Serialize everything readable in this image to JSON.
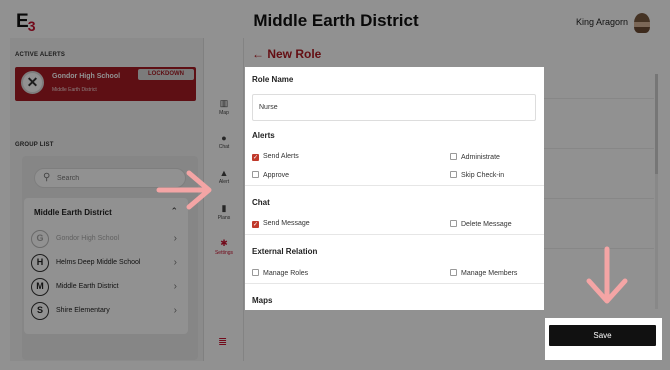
{
  "header": {
    "logo": "E",
    "logo_sub": "3",
    "title": "Middle Earth District",
    "user_name": "King Aragorn"
  },
  "sidebar": {
    "active_alerts_label": "ACTIVE ALERTS",
    "alert": {
      "school": "Gondor High School",
      "district": "Middle Earth District",
      "status": "LOCKDOWN"
    },
    "group_list_label": "GROUP LIST",
    "search_placeholder": "Search",
    "district_name": "Middle Earth District",
    "schools": [
      {
        "initial": "G",
        "name": "Gondor High School"
      },
      {
        "initial": "H",
        "name": "Helms Deep Middle School"
      },
      {
        "initial": "M",
        "name": "Middle Earth District"
      },
      {
        "initial": "S",
        "name": "Shire Elementary"
      }
    ]
  },
  "nav": {
    "items": [
      {
        "label": "Map",
        "icon": "map-icon"
      },
      {
        "label": "Chat",
        "icon": "chat-icon"
      },
      {
        "label": "Alert",
        "icon": "alert-icon"
      },
      {
        "label": "Plans",
        "icon": "plans-icon"
      },
      {
        "label": "Settings",
        "icon": "gear-icon"
      }
    ]
  },
  "page": {
    "title": "← New Role"
  },
  "form": {
    "role_name_label": "Role Name",
    "role_name_value": "Nurse",
    "sections": {
      "alerts": "Alerts",
      "chat": "Chat",
      "external": "External Relation",
      "maps": "Maps"
    },
    "alerts": {
      "send_alerts": "Send Alerts",
      "administrate": "Administrate",
      "approve": "Approve",
      "skip_checkin": "Skip Check-in"
    },
    "chat": {
      "send_message": "Send Message",
      "delete_message": "Delete Message"
    },
    "external": {
      "manage_roles": "Manage Roles",
      "manage_members": "Manage Members"
    },
    "save_label": "Save"
  },
  "colors": {
    "brand": "#c8102e",
    "alert_card": "#a51c24",
    "annotation_arrow": "#f4a5a5"
  }
}
